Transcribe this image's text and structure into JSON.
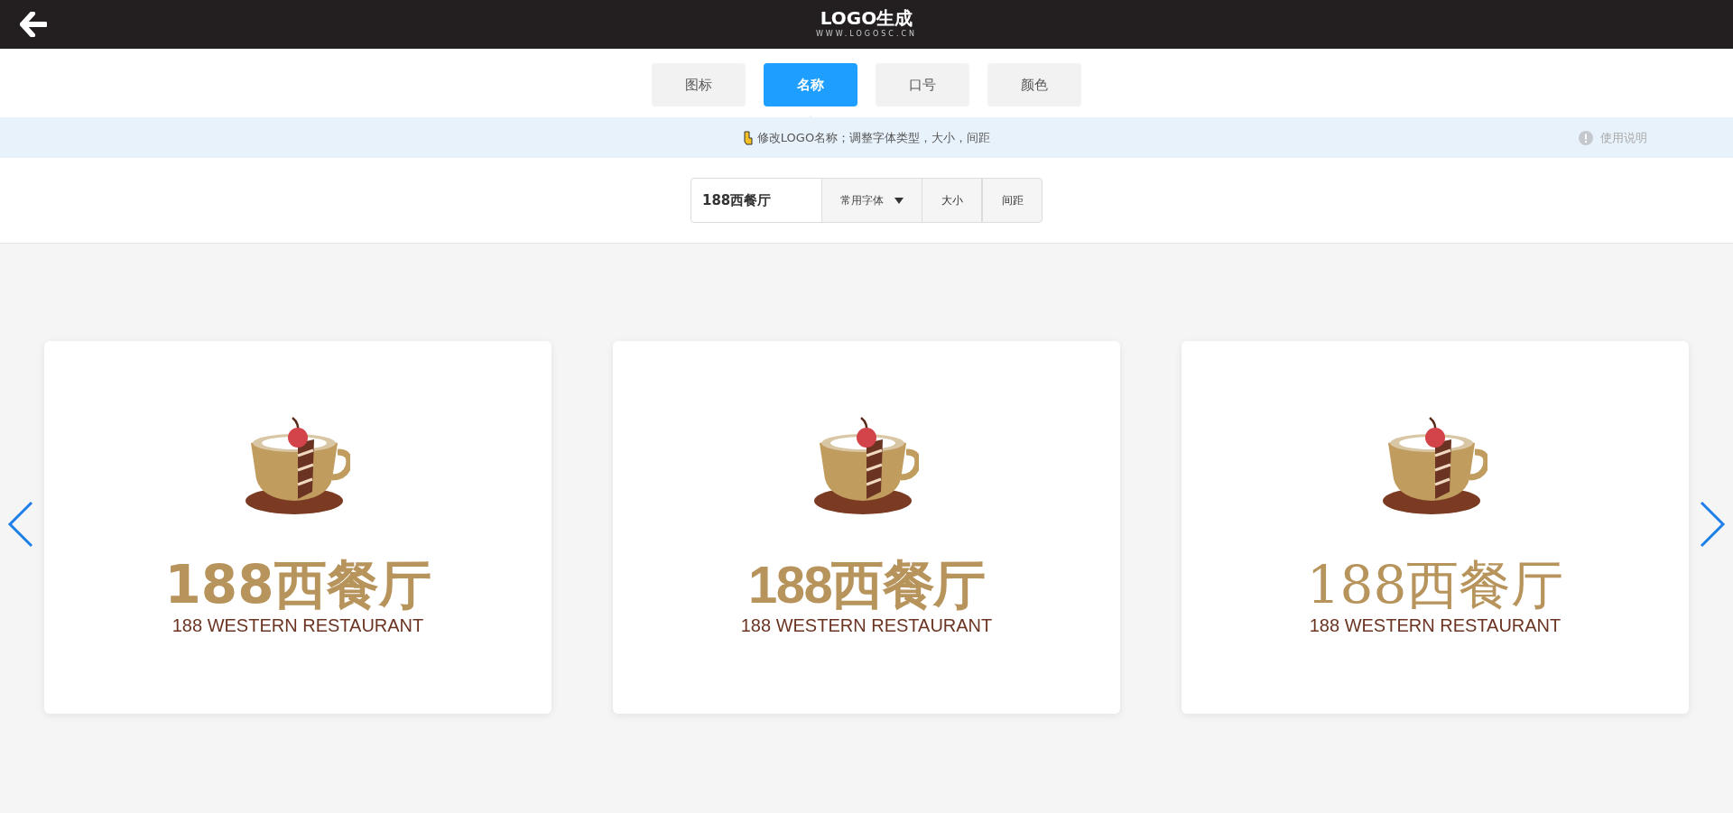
{
  "header": {
    "logo_text": "LOGO生成",
    "logo_url": "WWW.LOGOSC.CN"
  },
  "tabs": [
    {
      "label": "图标",
      "selected": false
    },
    {
      "label": "名称",
      "selected": true
    },
    {
      "label": "口号",
      "selected": false
    },
    {
      "label": "颜色",
      "selected": false
    }
  ],
  "tip": {
    "text": "修改LOGO名称；调整字体类型，大小，间距",
    "help": "使用说明"
  },
  "toolbar": {
    "name_value": "188西餐厅",
    "font_select": "常用字体",
    "buttons": [
      "大小",
      "间距"
    ]
  },
  "cards": [
    {
      "kind": "sans",
      "name": "188西餐厅",
      "subtitle": "188 WESTERN RESTAURANT"
    },
    {
      "kind": "display",
      "name": "188西餐厅",
      "subtitle": "188 WESTERN RESTAURANT"
    },
    {
      "kind": "serif",
      "name": "188西餐厅",
      "subtitle": "188 WESTERN RESTAURANT"
    }
  ]
}
